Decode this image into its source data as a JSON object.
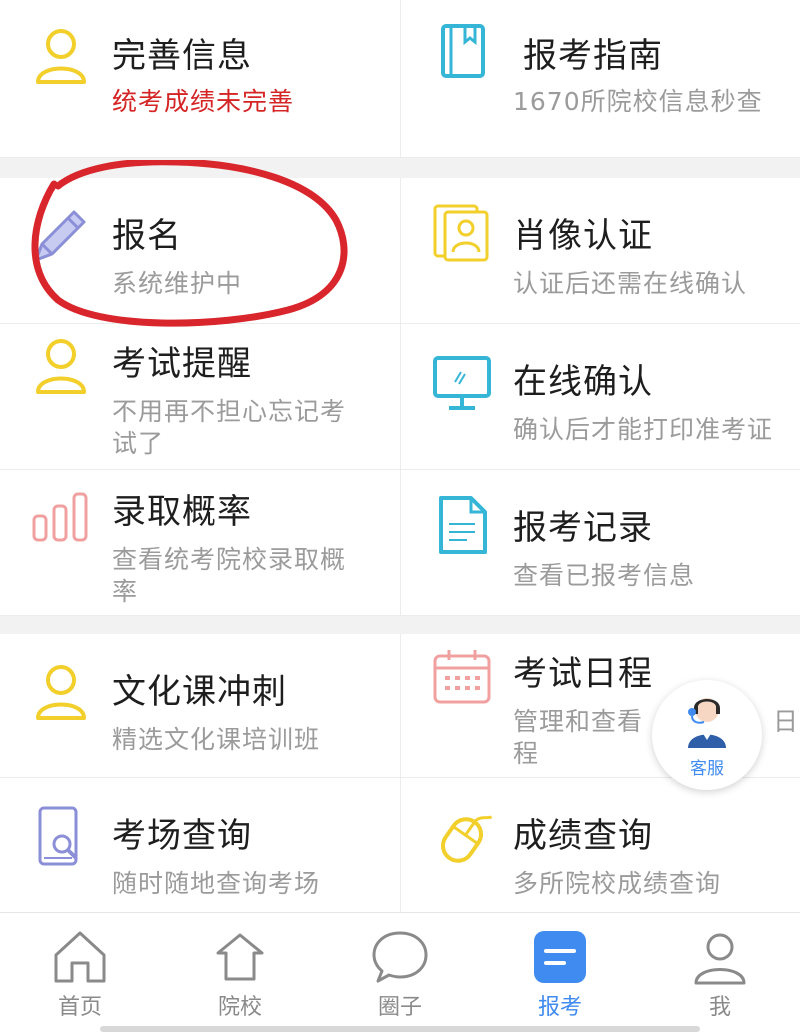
{
  "colors": {
    "accent": "#3f8bef",
    "warning_text": "#d42424",
    "yellow_icon": "#f2cf2a",
    "teal_icon": "#35b6d6",
    "pink_icon": "#f1a0a0",
    "purple_icon": "#8a8fd8"
  },
  "items": [
    {
      "title": "完善信息",
      "sub": "统考成绩未完善",
      "icon": "person-icon"
    },
    {
      "title": "报考指南",
      "sub": "1670所院校信息秒查",
      "icon": "book-icon"
    },
    {
      "title": "报名",
      "sub": "系统维护中",
      "icon": "pencil-icon"
    },
    {
      "title": "肖像认证",
      "sub": "认证后还需在线确认",
      "icon": "portrait-icon"
    },
    {
      "title": "考试提醒",
      "sub1": "不用再不担心忘记考",
      "sub2": "试了",
      "icon": "person-icon"
    },
    {
      "title": "在线确认",
      "sub": "确认后才能打印准考证",
      "icon": "monitor-icon"
    },
    {
      "title": "录取概率",
      "sub1": "查看统考院校录取概",
      "sub2": "率",
      "icon": "bar-chart-icon"
    },
    {
      "title": "报考记录",
      "sub": "查看已报考信息",
      "icon": "document-icon"
    },
    {
      "title": "文化课冲刺",
      "sub": "精选文化课培训班",
      "icon": "person-icon"
    },
    {
      "title": "考试日程",
      "sub1": "管理和查看",
      "sub1_tail": "日",
      "sub2": "程",
      "icon": "calendar-icon"
    },
    {
      "title": "考场查询",
      "sub": "随时随地查询考场",
      "icon": "phone-search-icon"
    },
    {
      "title": "成绩查询",
      "sub": "多所院校成绩查询",
      "icon": "mouse-icon"
    }
  ],
  "support": {
    "label": "客服",
    "icon": "customer-service-icon"
  },
  "tabs": [
    {
      "label": "首页",
      "icon": "home-icon"
    },
    {
      "label": "院校",
      "icon": "school-icon"
    },
    {
      "label": "圈子",
      "icon": "chat-bubble-icon"
    },
    {
      "label": "报考",
      "icon": "apply-icon"
    },
    {
      "label": "我",
      "icon": "user-icon"
    }
  ]
}
